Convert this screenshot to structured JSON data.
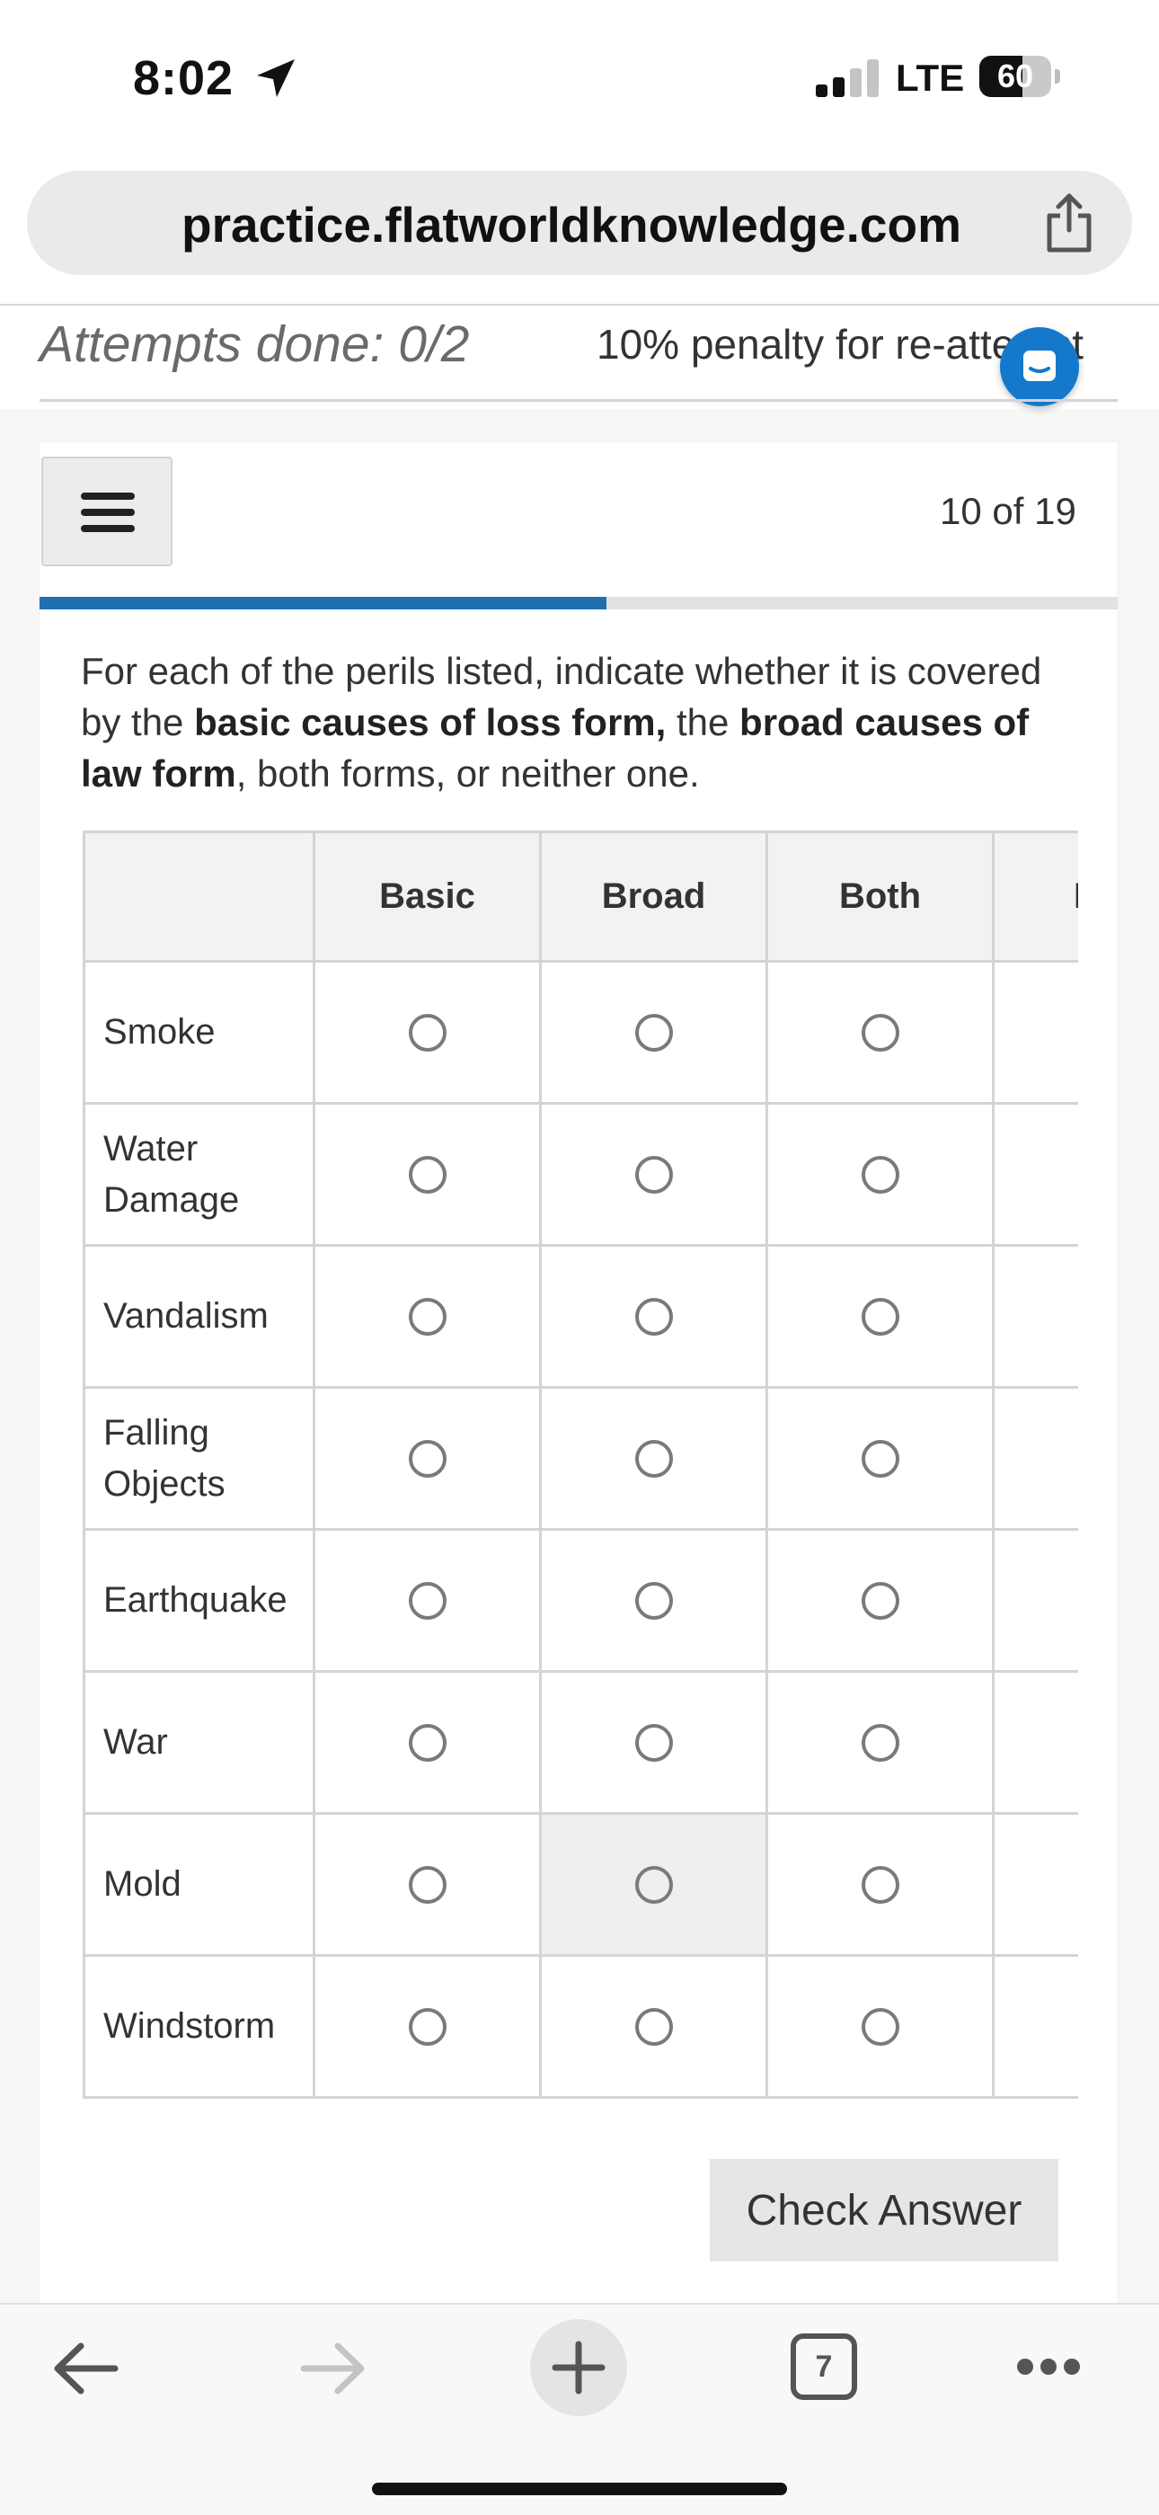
{
  "status_bar": {
    "time": "8:02",
    "network": "LTE",
    "battery": "60"
  },
  "browser": {
    "url": "practice.flatworldknowledge.com",
    "open_tabs": "7"
  },
  "assignment": {
    "attempts": "Attempts done: 0/2",
    "penalty": "10% penalty for re-attempt",
    "counter": "10 of 19",
    "progress_fraction": 0.526
  },
  "question": {
    "prompt_start": "For each of the perils listed, indicate whether it is covered by the ",
    "prompt_bold_1": "basic causes of loss form,",
    "prompt_mid": " the ",
    "prompt_bold_2": "broad causes of law form",
    "prompt_end": ", both forms, or neither one."
  },
  "table": {
    "columns": [
      "",
      "Basic",
      "Broad",
      "Both",
      "Neither"
    ],
    "rows": [
      "Smoke",
      "Water Damage",
      "Vandalism",
      "Falling Objects",
      "Earthquake",
      "War",
      "Mold",
      "Windstorm"
    ]
  },
  "actions": {
    "check_answer": "Check Answer"
  },
  "colors": {
    "accent_blue": "#1f6fb2",
    "chat_blue": "#1479cc"
  }
}
